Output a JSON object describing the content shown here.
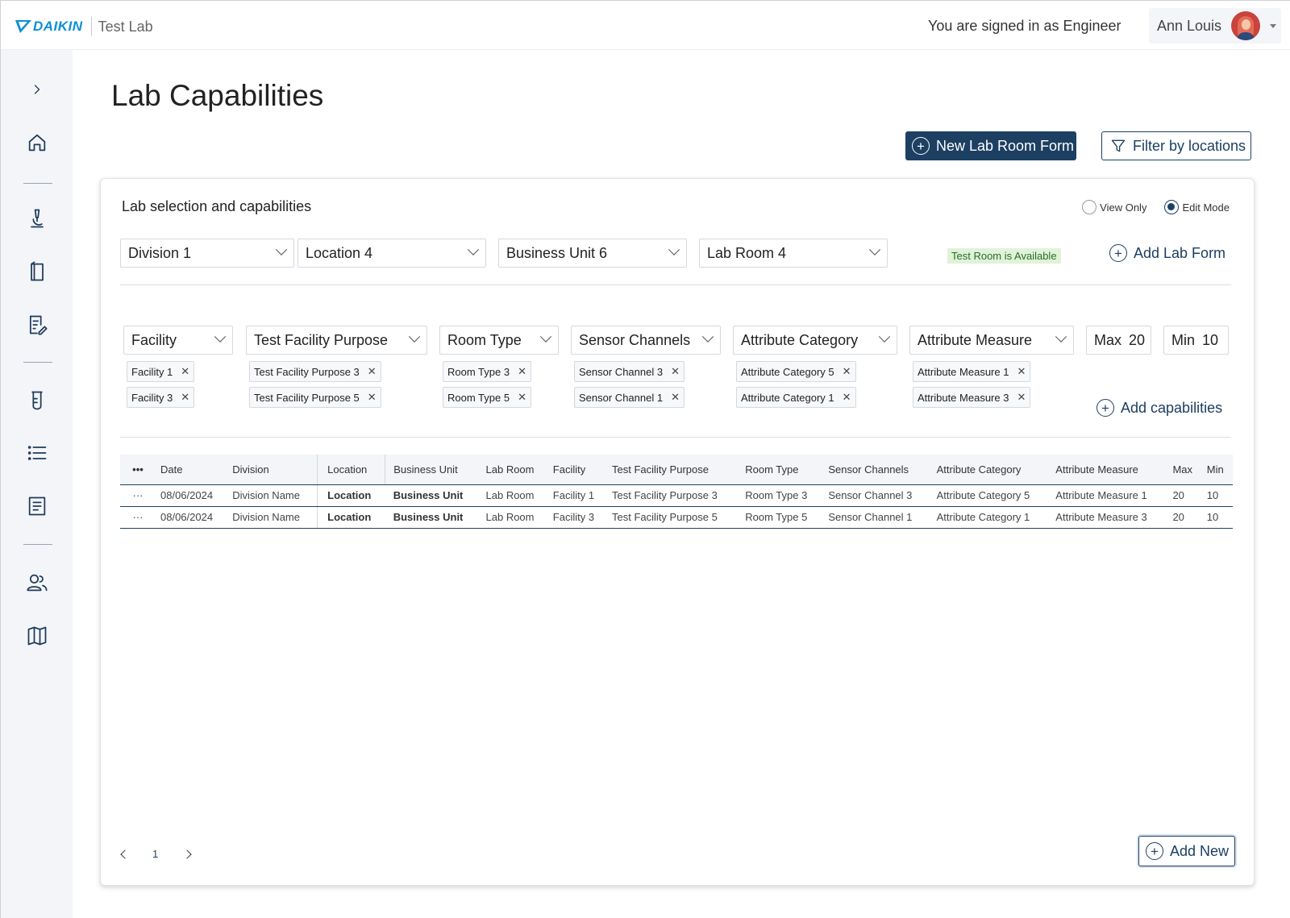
{
  "header": {
    "brand": "DAIKIN",
    "app_name": "Test Lab",
    "signed_in_text": "You are signed in as Engineer",
    "user_name": "Ann Louis"
  },
  "sidebar": {
    "items": [
      {
        "icon": "chevron-right-icon"
      },
      {
        "icon": "home-icon"
      },
      {
        "icon": "microscope-icon"
      },
      {
        "icon": "book-icon"
      },
      {
        "icon": "edit-document-icon"
      },
      {
        "icon": "test-tube-icon"
      },
      {
        "icon": "list-icon"
      },
      {
        "icon": "document-icon"
      },
      {
        "icon": "users-icon"
      },
      {
        "icon": "map-icon"
      }
    ]
  },
  "page": {
    "title": "Lab Capabilities",
    "new_form_label": "New Lab Room Form",
    "filter_label": "Filter by locations"
  },
  "card": {
    "title": "Lab selection and capabilities",
    "mode_view": "View Only",
    "mode_edit": "Edit Mode",
    "selected_mode": "Edit Mode",
    "division": "Division 1",
    "location": "Location 4",
    "business_unit": "Business Unit 6",
    "lab_room": "Lab Room 4",
    "availability": "Test Room is Available",
    "add_lab_form": "Add Lab Form",
    "add_capabilities": "Add capabilities",
    "add_new": "Add New"
  },
  "filters": {
    "facility": {
      "label": "Facility",
      "chips": [
        "Facility 1",
        "Facility 3"
      ]
    },
    "purpose": {
      "label": "Test Facility Purpose",
      "chips": [
        "Test Facility Purpose 3",
        "Test Facility Purpose 5"
      ]
    },
    "room_type": {
      "label": "Room Type",
      "chips": [
        "Room Type 3",
        "Room Type 5"
      ]
    },
    "sensor": {
      "label": "Sensor Channels",
      "chips": [
        "Sensor Channel 3",
        "Sensor Channel 1"
      ]
    },
    "attr_cat": {
      "label": "Attribute Category",
      "chips": [
        "Attribute Category 5",
        "Attribute Category 1"
      ]
    },
    "attr_meas": {
      "label": "Attribute Measure",
      "chips": [
        "Attribute Measure 1",
        "Attribute Measure 3"
      ]
    },
    "max": {
      "label": "Max",
      "value": "20"
    },
    "min": {
      "label": "Min",
      "value": "10"
    }
  },
  "table": {
    "menu": "•••",
    "headers": [
      "Date",
      "Division",
      "Location",
      "Business Unit",
      "Lab Room",
      "Facility",
      "Test Facility Purpose",
      "Room Type",
      "Sensor Channels",
      "Attribute Category",
      "Attribute Measure",
      "Max",
      "Min"
    ],
    "rows": [
      {
        "menu": "···",
        "cells": [
          "08/06/2024",
          "Division Name",
          "Location",
          "Business Unit",
          "Lab Room",
          "Facility 1",
          "Test Facility Purpose 3",
          "Room Type 3",
          "Sensor Channel 3",
          "Attribute Category 5",
          "Attribute Measure 1",
          "20",
          "10"
        ]
      },
      {
        "menu": "···",
        "cells": [
          "08/06/2024",
          "Division Name",
          "Location",
          "Business Unit",
          "Lab Room",
          "Facility 3",
          "Test Facility Purpose 5",
          "Room Type 5",
          "Sensor Channel 1",
          "Attribute Category 1",
          "Attribute Measure 3",
          "20",
          "10"
        ]
      }
    ]
  },
  "pagination": {
    "current": "1"
  },
  "colors": {
    "primary": "#1c3f62",
    "brand": "#0a8fd6",
    "available_bg": "#dff3d8"
  }
}
